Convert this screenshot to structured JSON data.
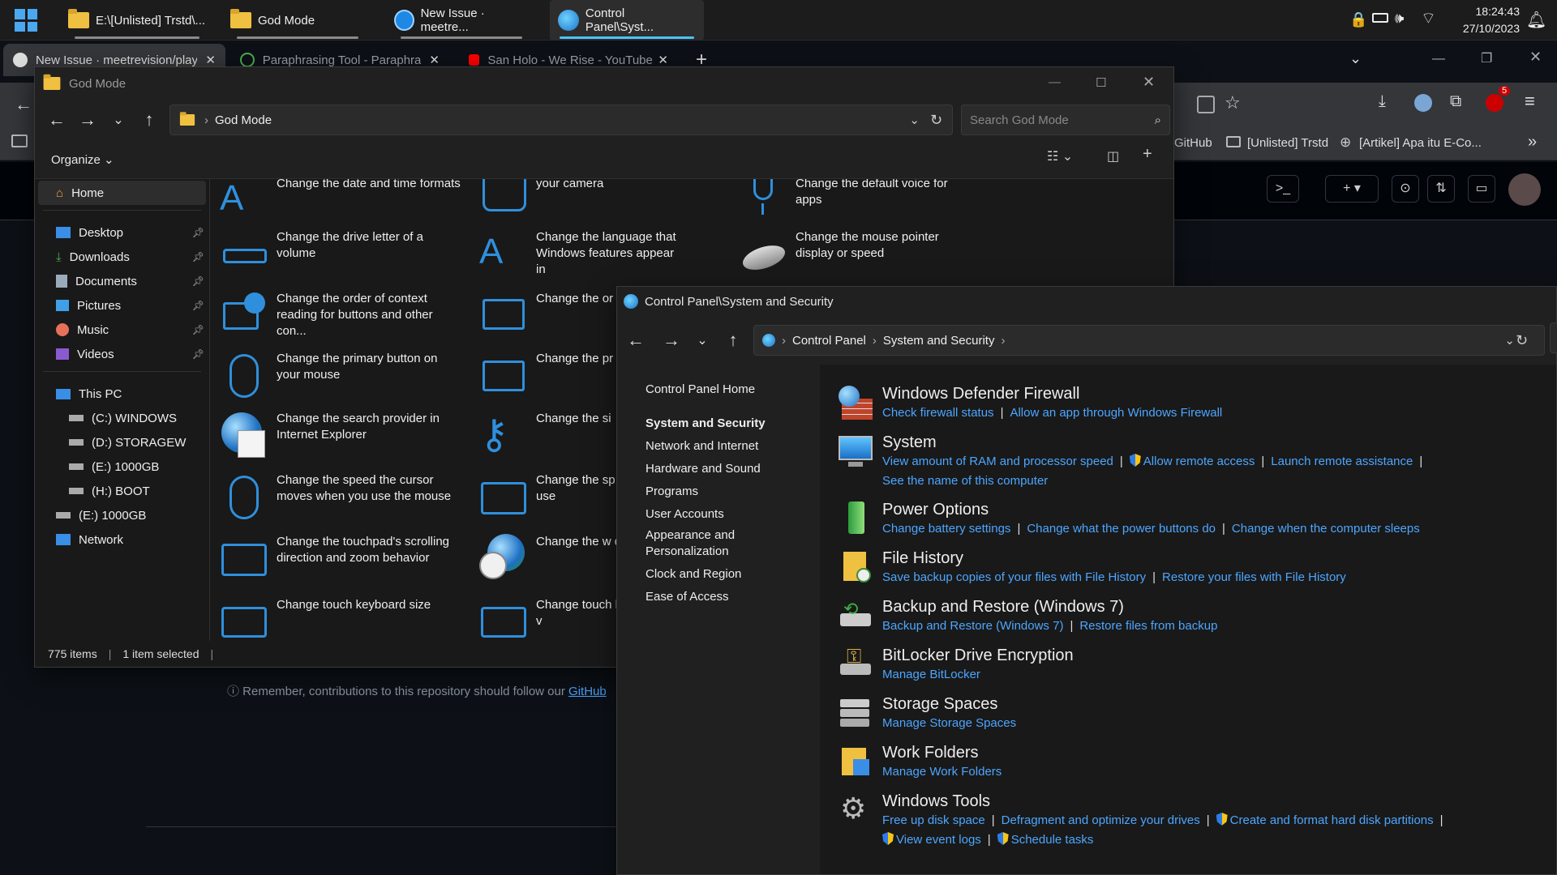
{
  "taskbar": {
    "tasks": [
      {
        "label": "E:\\[Unlisted] Trstd\\..."
      },
      {
        "label": "God Mode"
      },
      {
        "label": "New Issue · meetre..."
      },
      {
        "label": "Control Panel\\Syst..."
      }
    ],
    "clock": {
      "time": "18:24:43",
      "date": "27/10/2023"
    }
  },
  "browser": {
    "tabs": [
      {
        "label": "New Issue · meetrevision/playb"
      },
      {
        "label": "Paraphrasing Tool - Paraphrase"
      },
      {
        "label": "San Holo - We Rise - YouTube"
      }
    ],
    "new_tab": "+",
    "ext_badge": "5",
    "bookmarks": [
      "GitHub",
      "[Unlisted] Trstd",
      "[Artikel] Apa itu E-Co..."
    ],
    "footer_text": "Remember, contributions to this repository should follow our",
    "footer_link": "GitHub"
  },
  "explorer": {
    "title": "God Mode",
    "address": "God Mode",
    "search_placeholder": "Search God Mode",
    "organize": "Organize",
    "sidebar": [
      {
        "label": "Home",
        "pin": false
      },
      {
        "label": "Desktop",
        "pin": true
      },
      {
        "label": "Downloads",
        "pin": true
      },
      {
        "label": "Documents",
        "pin": true
      },
      {
        "label": "Pictures",
        "pin": true
      },
      {
        "label": "Music",
        "pin": true
      },
      {
        "label": "Videos",
        "pin": true
      },
      {
        "label": "This PC",
        "pin": false
      },
      {
        "label": "(C:) WINDOWS",
        "pin": false
      },
      {
        "label": "(D:) STORAGEW",
        "pin": false
      },
      {
        "label": "(E:) 1000GB",
        "pin": false
      },
      {
        "label": "(H:) BOOT",
        "pin": false
      },
      {
        "label": "(E:) 1000GB",
        "pin": false
      },
      {
        "label": "Network",
        "pin": false
      }
    ],
    "items_col1": [
      "Change the date and time formats",
      "Change the drive letter of a volume",
      "Change the order of context reading for buttons and other con...",
      "Change the primary button on your mouse",
      "Change the search provider in Internet Explorer",
      "Change the speed the cursor moves when you use the mouse",
      "Change the touchpad's scrolling direction and zoom behavior",
      "Change touch keyboard size"
    ],
    "items_col2": [
      "your camera",
      "Change the language that Windows features appear in",
      "Change the or display",
      "Change the pr",
      "Change the si",
      "Change the sp when you use",
      "Change the w displayed",
      "Change touch background v"
    ],
    "items_col3": [
      "Change the default voice for apps",
      "Change the mouse pointer display or speed"
    ],
    "status": {
      "count": "775 items",
      "selected": "1 item selected"
    }
  },
  "cpanel": {
    "title": "Control Panel\\System and Security",
    "breadcrumb": [
      "Control Panel",
      "System and Security"
    ],
    "left_nav": [
      "Control Panel Home",
      "System and Security",
      "Network and Internet",
      "Hardware and Sound",
      "Programs",
      "User Accounts",
      "Appearance and Personalization",
      "Clock and Region",
      "Ease of Access"
    ],
    "sections": [
      {
        "title": "Windows Defender Firewall",
        "links": [
          "Check firewall status",
          "Allow an app through Windows Firewall"
        ]
      },
      {
        "title": "System",
        "links": [
          "View amount of RAM and processor speed",
          "Allow remote access",
          "Launch remote assistance",
          "See the name of this computer"
        ]
      },
      {
        "title": "Power Options",
        "links": [
          "Change battery settings",
          "Change what the power buttons do",
          "Change when the computer sleeps"
        ]
      },
      {
        "title": "File History",
        "links": [
          "Save backup copies of your files with File History",
          "Restore your files with File History"
        ]
      },
      {
        "title": "Backup and Restore (Windows 7)",
        "links": [
          "Backup and Restore (Windows 7)",
          "Restore files from backup"
        ]
      },
      {
        "title": "BitLocker Drive Encryption",
        "links": [
          "Manage BitLocker"
        ]
      },
      {
        "title": "Storage Spaces",
        "links": [
          "Manage Storage Spaces"
        ]
      },
      {
        "title": "Work Folders",
        "links": [
          "Manage Work Folders"
        ]
      },
      {
        "title": "Windows Tools",
        "links": [
          "Free up disk space",
          "Defragment and optimize your drives",
          "Create and format hard disk partitions",
          "View event logs",
          "Schedule tasks"
        ]
      }
    ]
  },
  "colors": {
    "accent": "#4cc2ff",
    "link": "#4ca6ff",
    "icon_blue": "#2f8fdc"
  }
}
